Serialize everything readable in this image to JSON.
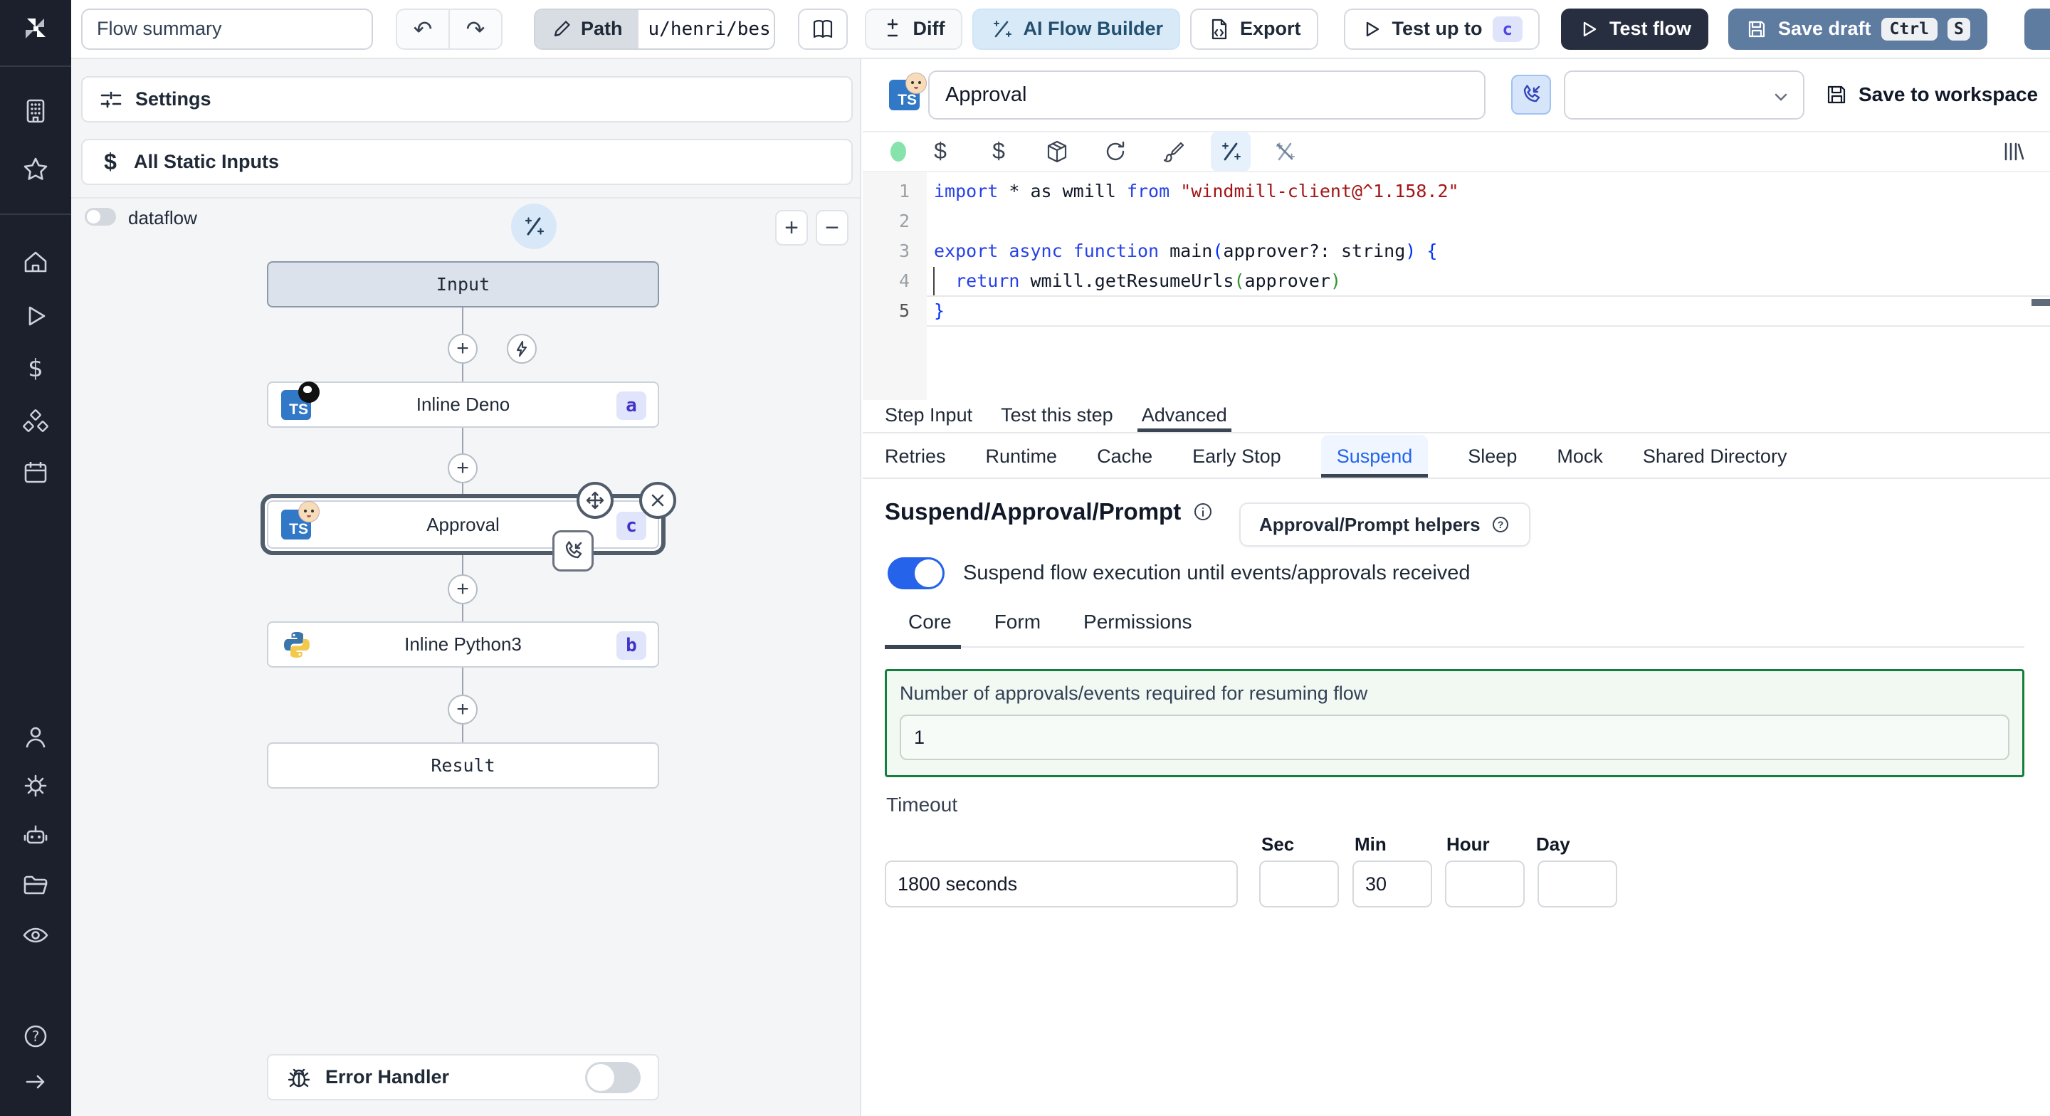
{
  "topbar": {
    "flow_summary_value": "Flow summary",
    "path_label": "Path",
    "path_value": "u/henri/bes",
    "diff_label": "Diff",
    "ai_flow_builder_label": "AI Flow Builder",
    "export_label": "Export",
    "test_up_to_label": "Test up to",
    "test_up_to_badge": "c",
    "test_flow_label": "Test flow",
    "save_draft_label": "Save draft",
    "save_draft_kbd_1": "Ctrl",
    "save_draft_kbd_2": "S"
  },
  "flow_panel": {
    "settings_label": "Settings",
    "static_inputs_label": "All Static Inputs",
    "dataflow_label": "dataflow",
    "zoom_in": "+",
    "zoom_out": "−",
    "ts_badge": "TS",
    "nodes": {
      "input": {
        "label": "Input"
      },
      "deno": {
        "label": "Inline Deno",
        "badge": "a"
      },
      "approval": {
        "label": "Approval",
        "badge": "c"
      },
      "python": {
        "label": "Inline Python3",
        "badge": "b"
      },
      "result": {
        "label": "Result"
      }
    },
    "error_handler_label": "Error Handler"
  },
  "editor": {
    "title_value": "Approval",
    "save_to_workspace_label": "Save to workspace",
    "gutter": [
      "1",
      "2",
      "3",
      "4",
      "5"
    ],
    "code": {
      "l1": {
        "k1": "import",
        "p1": " * as wmill ",
        "k2": "from",
        "s1": " \"windmill-client@^1.158.2\""
      },
      "l3": {
        "k1": "export async function",
        "p1": " main",
        "b1": "(",
        "p2": "approver?: string",
        "b2": ")",
        "p3": " ",
        "b3": "{"
      },
      "l4": {
        "ind": "  ",
        "k1": "return",
        "p1": " wmill.getResumeUrls",
        "b1": "(",
        "p2": "approver",
        "b2": ")"
      },
      "l5": {
        "b1": "}"
      }
    }
  },
  "tabs": {
    "step": [
      "Step Input",
      "Test this step",
      "Advanced"
    ],
    "advanced": [
      "Retries",
      "Runtime",
      "Cache",
      "Early Stop",
      "Suspend",
      "Sleep",
      "Mock",
      "Shared Directory"
    ]
  },
  "suspend": {
    "heading": "Suspend/Approval/Prompt",
    "helpers_button_label": "Approval/Prompt helpers",
    "toggle_label": "Suspend flow execution until events/approvals received",
    "sub_tabs": [
      "Core",
      "Form",
      "Permissions"
    ],
    "approvals_label": "Number of approvals/events required for resuming flow",
    "approvals_value": "1",
    "timeout_label": "Timeout",
    "timeout_value": "1800 seconds",
    "units": [
      "Sec",
      "Min",
      "Hour",
      "Day"
    ],
    "min_value": "30"
  },
  "colors": {
    "accent_blue": "#2563eb",
    "suspend_tab_blue": "#2563eb",
    "badge_indigo": "#4034c8",
    "save_draft_bg": "#5e7ba0",
    "test_flow_bg": "#272e3f",
    "ai_builder_bg": "#d8e9f8",
    "green_frame": "#15803d",
    "ts_logo_blue": "#3178c6",
    "sidebar_bg": "#1b202c",
    "status_dot_green": "#86e3ab"
  },
  "icon_names": [
    "windmill-logo",
    "building-icon",
    "star-icon",
    "home-icon",
    "runs-play-icon",
    "variables-dollar-icon",
    "resources-cubes-icon",
    "schedules-calendar-icon",
    "user-icon",
    "gear-icon",
    "robot-icon",
    "folder-icon",
    "eye-icon",
    "help-icon",
    "expand-arrow-icon",
    "undo-icon",
    "redo-icon",
    "pencil-icon",
    "book-icon",
    "diff-icon",
    "wand-icon",
    "export-file-icon",
    "play-icon",
    "save-icon",
    "phone-incoming-icon",
    "chevron-down-icon",
    "package-icon",
    "refresh-icon",
    "brush-icon",
    "wand-off-icon",
    "library-icon",
    "plus-icon",
    "lightning-icon",
    "move-icon",
    "close-icon",
    "bug-icon",
    "info-icon",
    "question-icon",
    "sliders-icon"
  ]
}
